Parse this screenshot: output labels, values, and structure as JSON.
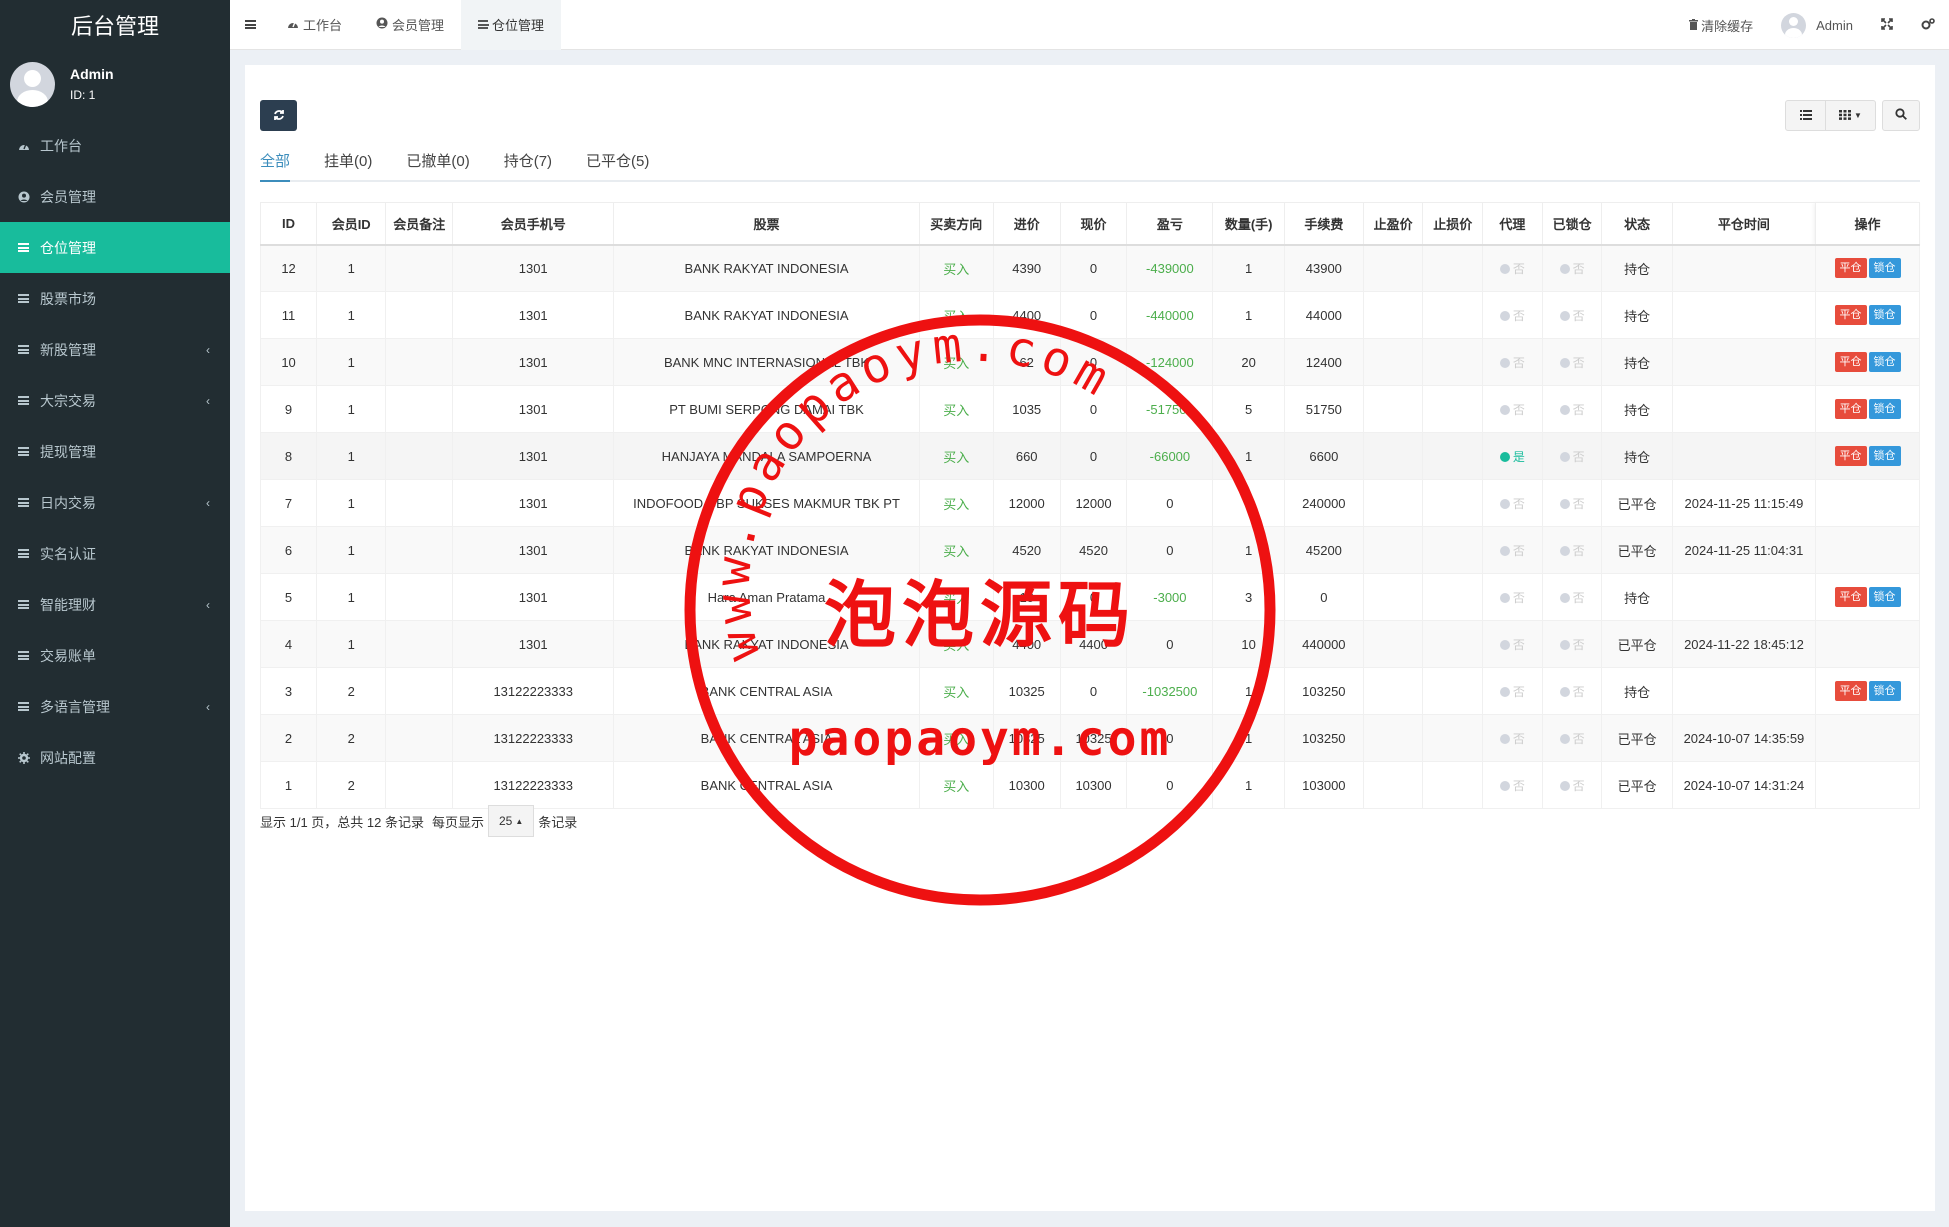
{
  "brand": "后台管理",
  "user": {
    "name": "Admin",
    "id_label": "ID: 1"
  },
  "sidebar": {
    "items": [
      {
        "label": "工作台",
        "icon": "dashboard-icon",
        "active": false,
        "has_children": false
      },
      {
        "label": "会员管理",
        "icon": "user-circle-icon",
        "active": false,
        "has_children": false
      },
      {
        "label": "仓位管理",
        "icon": "list-icon",
        "active": true,
        "has_children": false
      },
      {
        "label": "股票市场",
        "icon": "list-icon",
        "active": false,
        "has_children": false
      },
      {
        "label": "新股管理",
        "icon": "list-icon",
        "active": false,
        "has_children": true
      },
      {
        "label": "大宗交易",
        "icon": "list-icon",
        "active": false,
        "has_children": true
      },
      {
        "label": "提现管理",
        "icon": "list-icon",
        "active": false,
        "has_children": false
      },
      {
        "label": "日内交易",
        "icon": "list-icon",
        "active": false,
        "has_children": true
      },
      {
        "label": "实名认证",
        "icon": "list-icon",
        "active": false,
        "has_children": false
      },
      {
        "label": "智能理财",
        "icon": "list-icon",
        "active": false,
        "has_children": true
      },
      {
        "label": "交易账单",
        "icon": "list-icon",
        "active": false,
        "has_children": false
      },
      {
        "label": "多语言管理",
        "icon": "list-icon",
        "active": false,
        "has_children": true
      },
      {
        "label": "网站配置",
        "icon": "gears-icon",
        "active": false,
        "has_children": false
      }
    ]
  },
  "header": {
    "tabs": [
      {
        "label": "工作台",
        "icon": "dashboard-icon",
        "active": false
      },
      {
        "label": "会员管理",
        "icon": "user-circle-icon",
        "active": false
      },
      {
        "label": "仓位管理",
        "icon": "list-icon",
        "active": true
      }
    ],
    "clear_cache": "清除缓存",
    "user": "Admin"
  },
  "filter_tabs": [
    "全部",
    "挂单(0)",
    "已撤单(0)",
    "持仓(7)",
    "已平仓(5)"
  ],
  "table": {
    "columns": [
      "ID",
      "会员ID",
      "会员备注",
      "会员手机号",
      "股票",
      "买卖方向",
      "进价",
      "现价",
      "盈亏",
      "数量(手)",
      "手续费",
      "止盈价",
      "止损价",
      "代理",
      "已锁仓",
      "状态",
      "平仓时间",
      "操作"
    ],
    "rows": [
      {
        "id": "12",
        "member_id": "1",
        "remark": "",
        "phone": "1301",
        "stock": "BANK RAKYAT INDONESIA",
        "direction": "买入",
        "entry": "4390",
        "current": "0",
        "pnl": "-439000",
        "pnl_green": true,
        "qty": "1",
        "fee": "43900",
        "tp": "",
        "sl": "",
        "agent": "否",
        "locked": "否",
        "status": "持仓",
        "close_time": "",
        "actions": true
      },
      {
        "id": "11",
        "member_id": "1",
        "remark": "",
        "phone": "1301",
        "stock": "BANK RAKYAT INDONESIA",
        "direction": "买入",
        "entry": "4400",
        "current": "0",
        "pnl": "-440000",
        "pnl_green": true,
        "qty": "1",
        "fee": "44000",
        "tp": "",
        "sl": "",
        "agent": "否",
        "locked": "否",
        "status": "持仓",
        "close_time": "",
        "actions": true
      },
      {
        "id": "10",
        "member_id": "1",
        "remark": "",
        "phone": "1301",
        "stock": "BANK MNC INTERNASIONAL TBK",
        "direction": "买入",
        "entry": "62",
        "current": "0",
        "pnl": "-124000",
        "pnl_green": true,
        "qty": "20",
        "fee": "12400",
        "tp": "",
        "sl": "",
        "agent": "否",
        "locked": "否",
        "status": "持仓",
        "close_time": "",
        "actions": true
      },
      {
        "id": "9",
        "member_id": "1",
        "remark": "",
        "phone": "1301",
        "stock": "PT BUMI SERPONG DAMAI TBK",
        "direction": "买入",
        "entry": "1035",
        "current": "0",
        "pnl": "-517500",
        "pnl_green": true,
        "qty": "5",
        "fee": "51750",
        "tp": "",
        "sl": "",
        "agent": "否",
        "locked": "否",
        "status": "持仓",
        "close_time": "",
        "actions": true
      },
      {
        "id": "8",
        "member_id": "1",
        "remark": "",
        "phone": "1301",
        "stock": "HANJAYA MANDALA SAMPOERNA",
        "direction": "买入",
        "entry": "660",
        "current": "0",
        "pnl": "-66000",
        "pnl_green": true,
        "qty": "1",
        "fee": "6600",
        "tp": "",
        "sl": "",
        "agent": "是",
        "locked": "否",
        "status": "持仓",
        "close_time": "",
        "actions": true
      },
      {
        "id": "7",
        "member_id": "1",
        "remark": "",
        "phone": "1301",
        "stock": "INDOFOOD CBP SUKSES MAKMUR TBK PT",
        "direction": "买入",
        "entry": "12000",
        "current": "12000",
        "pnl": "0",
        "pnl_green": false,
        "qty": "2",
        "fee": "240000",
        "tp": "",
        "sl": "",
        "agent": "否",
        "locked": "否",
        "status": "已平仓",
        "close_time": "2024-11-25 11:15:49",
        "actions": false
      },
      {
        "id": "6",
        "member_id": "1",
        "remark": "",
        "phone": "1301",
        "stock": "BANK RAKYAT INDONESIA",
        "direction": "买入",
        "entry": "4520",
        "current": "4520",
        "pnl": "0",
        "pnl_green": false,
        "qty": "1",
        "fee": "45200",
        "tp": "",
        "sl": "",
        "agent": "否",
        "locked": "否",
        "status": "已平仓",
        "close_time": "2024-11-25 11:04:31",
        "actions": false
      },
      {
        "id": "5",
        "member_id": "1",
        "remark": "",
        "phone": "1301",
        "stock": "Hara Aman Pratama",
        "direction": "买入",
        "entry": "10",
        "current": "0",
        "pnl": "-3000",
        "pnl_green": true,
        "qty": "3",
        "fee": "0",
        "tp": "",
        "sl": "",
        "agent": "否",
        "locked": "否",
        "status": "持仓",
        "close_time": "",
        "actions": true
      },
      {
        "id": "4",
        "member_id": "1",
        "remark": "",
        "phone": "1301",
        "stock": "BANK RAKYAT INDONESIA",
        "direction": "买入",
        "entry": "4400",
        "current": "4400",
        "pnl": "0",
        "pnl_green": false,
        "qty": "10",
        "fee": "440000",
        "tp": "",
        "sl": "",
        "agent": "否",
        "locked": "否",
        "status": "已平仓",
        "close_time": "2024-11-22 18:45:12",
        "actions": false
      },
      {
        "id": "3",
        "member_id": "2",
        "remark": "",
        "phone": "13122223333",
        "stock": "BANK CENTRAL ASIA",
        "direction": "买入",
        "entry": "10325",
        "current": "0",
        "pnl": "-1032500",
        "pnl_green": true,
        "qty": "1",
        "fee": "103250",
        "tp": "",
        "sl": "",
        "agent": "否",
        "locked": "否",
        "status": "持仓",
        "close_time": "",
        "actions": true
      },
      {
        "id": "2",
        "member_id": "2",
        "remark": "",
        "phone": "13122223333",
        "stock": "BANK CENTRAL ASIA",
        "direction": "买入",
        "entry": "10325",
        "current": "10325",
        "pnl": "0",
        "pnl_green": false,
        "qty": "1",
        "fee": "103250",
        "tp": "",
        "sl": "",
        "agent": "否",
        "locked": "否",
        "status": "已平仓",
        "close_time": "2024-10-07 14:35:59",
        "actions": false
      },
      {
        "id": "1",
        "member_id": "2",
        "remark": "",
        "phone": "13122223333",
        "stock": "BANK CENTRAL ASIA",
        "direction": "买入",
        "entry": "10300",
        "current": "10300",
        "pnl": "0",
        "pnl_green": false,
        "qty": "1",
        "fee": "103000",
        "tp": "",
        "sl": "",
        "agent": "否",
        "locked": "否",
        "status": "已平仓",
        "close_time": "2024-10-07 14:31:24",
        "actions": false
      }
    ],
    "action_close": "平仓",
    "action_lock": "锁仓"
  },
  "pagination": {
    "summary": "显示 1/1 页，总共 12 条记录",
    "per_page_label": "每页显示",
    "per_page_value": "25",
    "suffix": "条记录"
  },
  "watermark": {
    "arc_text": "www.paopaoym.com",
    "center_text": "泡泡源码",
    "bottom_text": "paopaoym.com",
    "color": "#ee1111"
  },
  "colors": {
    "sidebar_bg": "#222d32",
    "accent": "#18bc9c",
    "link": "#3c8dbc",
    "btn_red": "#e74c3c",
    "btn_blue": "#3498db"
  }
}
